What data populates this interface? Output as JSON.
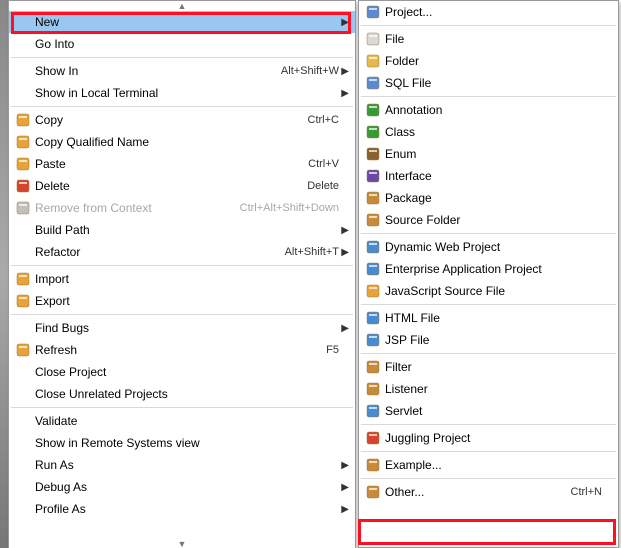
{
  "left_menu": {
    "items": [
      {
        "label": "New",
        "accel": "",
        "arrow": true,
        "selected": true,
        "icon": "none"
      },
      {
        "label": "Go Into",
        "accel": "",
        "arrow": false,
        "icon": "none"
      },
      {
        "sep": true
      },
      {
        "label": "Show In",
        "accel": "Alt+Shift+W",
        "arrow": true,
        "icon": "none"
      },
      {
        "label": "Show in Local Terminal",
        "accel": "",
        "arrow": true,
        "icon": "none"
      },
      {
        "sep": true
      },
      {
        "label": "Copy",
        "accel": "Ctrl+C",
        "arrow": false,
        "icon": "copy"
      },
      {
        "label": "Copy Qualified Name",
        "accel": "",
        "arrow": false,
        "icon": "copy-q"
      },
      {
        "label": "Paste",
        "accel": "Ctrl+V",
        "arrow": false,
        "icon": "paste"
      },
      {
        "label": "Delete",
        "accel": "Delete",
        "arrow": false,
        "icon": "delete"
      },
      {
        "label": "Remove from Context",
        "accel": "Ctrl+Alt+Shift+Down",
        "arrow": false,
        "icon": "remove",
        "disabled": true
      },
      {
        "label": "Build Path",
        "accel": "",
        "arrow": true,
        "icon": "none"
      },
      {
        "label": "Refactor",
        "accel": "Alt+Shift+T",
        "arrow": true,
        "icon": "none"
      },
      {
        "sep": true
      },
      {
        "label": "Import",
        "accel": "",
        "arrow": false,
        "icon": "import"
      },
      {
        "label": "Export",
        "accel": "",
        "arrow": false,
        "icon": "export"
      },
      {
        "sep": true
      },
      {
        "label": "Find Bugs",
        "accel": "",
        "arrow": true,
        "icon": "none"
      },
      {
        "label": "Refresh",
        "accel": "F5",
        "arrow": false,
        "icon": "refresh"
      },
      {
        "label": "Close Project",
        "accel": "",
        "arrow": false,
        "icon": "none"
      },
      {
        "label": "Close Unrelated Projects",
        "accel": "",
        "arrow": false,
        "icon": "none"
      },
      {
        "sep": true
      },
      {
        "label": "Validate",
        "accel": "",
        "arrow": false,
        "icon": "none"
      },
      {
        "label": "Show in Remote Systems view",
        "accel": "",
        "arrow": false,
        "icon": "none"
      },
      {
        "label": "Run As",
        "accel": "",
        "arrow": true,
        "icon": "none"
      },
      {
        "label": "Debug As",
        "accel": "",
        "arrow": true,
        "icon": "none"
      },
      {
        "label": "Profile As",
        "accel": "",
        "arrow": true,
        "icon": "none"
      }
    ]
  },
  "right_menu": {
    "items": [
      {
        "label": "Project...",
        "icon": "project"
      },
      {
        "sep": true
      },
      {
        "label": "File",
        "icon": "file"
      },
      {
        "label": "Folder",
        "icon": "folder"
      },
      {
        "label": "SQL File",
        "icon": "sql"
      },
      {
        "sep": true
      },
      {
        "label": "Annotation",
        "icon": "annotation"
      },
      {
        "label": "Class",
        "icon": "class"
      },
      {
        "label": "Enum",
        "icon": "enum"
      },
      {
        "label": "Interface",
        "icon": "interface"
      },
      {
        "label": "Package",
        "icon": "package"
      },
      {
        "label": "Source Folder",
        "icon": "srcfolder"
      },
      {
        "sep": true
      },
      {
        "label": "Dynamic Web Project",
        "icon": "dynweb"
      },
      {
        "label": "Enterprise Application Project",
        "icon": "ear"
      },
      {
        "label": "JavaScript Source File",
        "icon": "js"
      },
      {
        "sep": true
      },
      {
        "label": "HTML File",
        "icon": "html"
      },
      {
        "label": "JSP File",
        "icon": "jsp"
      },
      {
        "sep": true
      },
      {
        "label": "Filter",
        "icon": "filter"
      },
      {
        "label": "Listener",
        "icon": "listener"
      },
      {
        "label": "Servlet",
        "icon": "servlet"
      },
      {
        "sep": true
      },
      {
        "label": "Juggling Project",
        "icon": "jug"
      },
      {
        "sep": true
      },
      {
        "label": "Example...",
        "icon": "example"
      },
      {
        "sep": true
      },
      {
        "label": "Other...",
        "accel": "Ctrl+N",
        "icon": "other"
      }
    ]
  }
}
